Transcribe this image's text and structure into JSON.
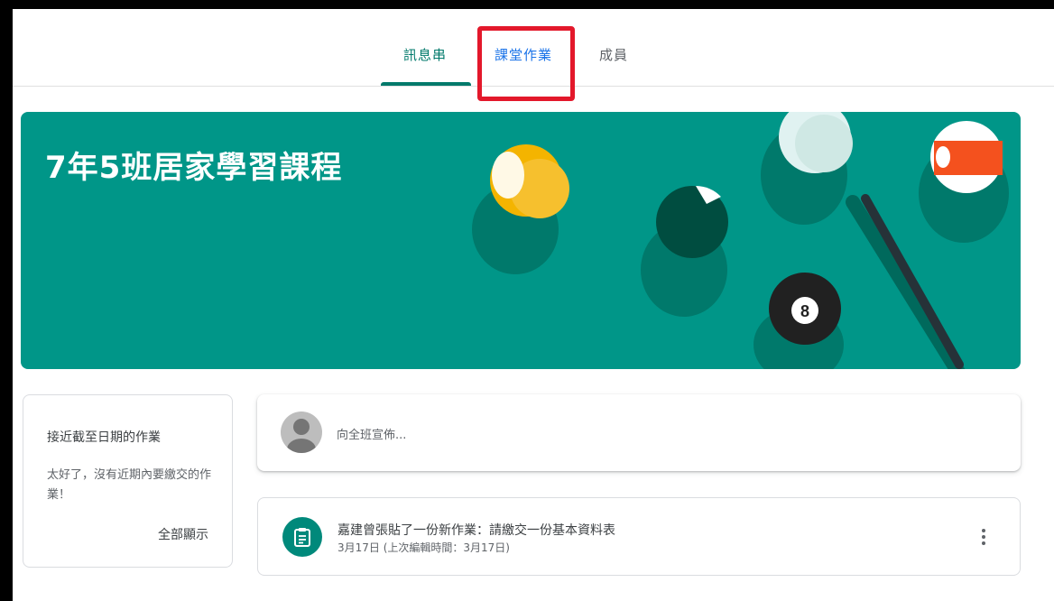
{
  "nav": {
    "tabs": [
      {
        "label": "訊息串",
        "active": true
      },
      {
        "label": "課堂作業",
        "active": false
      },
      {
        "label": "成員",
        "active": false
      }
    ],
    "highlight_color": "#e3182b"
  },
  "banner": {
    "title": "7年5班居家學習課程",
    "color": "#009688"
  },
  "upcoming": {
    "title": "接近截至日期的作業",
    "message": "太好了，沒有近期內要繳交的作業！",
    "view_all": "全部顯示"
  },
  "announce": {
    "placeholder": "向全班宣佈..."
  },
  "post": {
    "icon": "assignment-icon",
    "title": "嘉建曾張貼了一份新作業：請繳交一份基本資料表",
    "date": "3月17日 (上次編輯時間：3月17日)"
  },
  "colors": {
    "accent": "#00796b",
    "selected_tab_text": "#1a73e8"
  }
}
